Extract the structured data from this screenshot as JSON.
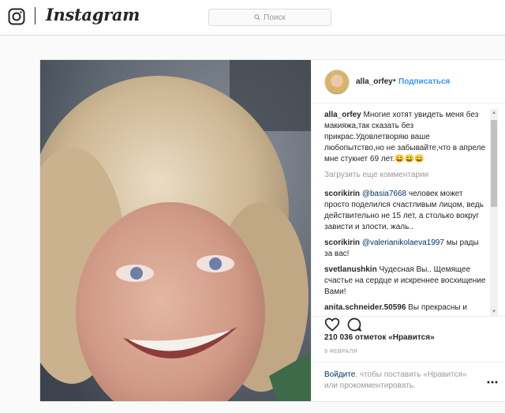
{
  "nav": {
    "brand": "Instagram",
    "search_placeholder": "Поиск"
  },
  "post": {
    "username": "alla_orfey",
    "separator": "•",
    "follow_label": "Подписаться",
    "caption_user": "alla_orfey",
    "caption_text": "Многие хотят увидеть меня без макияжа,так сказать без прикрас.Удовлетворяю ваше любопытство,но не забывайте,что в апреле мне стукнет 69 лет.😀😀😀",
    "load_more": "Загрузить еще комментарии",
    "comments": [
      {
        "user": "scorikirin",
        "mention": "@basia7668",
        "text": " человек может просто поделился счастливым лицом, ведь действительно не 15 лет, а столько вокруг зависти и злости, жаль.."
      },
      {
        "user": "scorikirin",
        "mention": "@valerianikolaeva1997",
        "text": " мы рады за вас!"
      },
      {
        "user": "svetlanushkin",
        "mention": "",
        "text": " Чудесная Вы.. Щемящее счастье на сердце и искреннее восхищение Вами!"
      },
      {
        "user": "anita.schneider.50596",
        "mention": "",
        "text": " Вы прекрасны и естественны. Самая красивая бабушка, самая нежная мама, самая любимая жена"
      }
    ],
    "likes": "210 036 отметок «Нравится»",
    "date": "9 ФЕВРАЛЯ",
    "cta_login": "Войдите",
    "cta_text": ", чтобы поставить «Нравится» или прокомментировать.",
    "icons": [
      "instagram-camera-icon",
      "search-icon",
      "heart-icon",
      "comment-icon",
      "more-options-icon"
    ]
  },
  "colors": {
    "link_blue": "#3897f0",
    "dark_link": "#003569",
    "muted": "#999999"
  }
}
